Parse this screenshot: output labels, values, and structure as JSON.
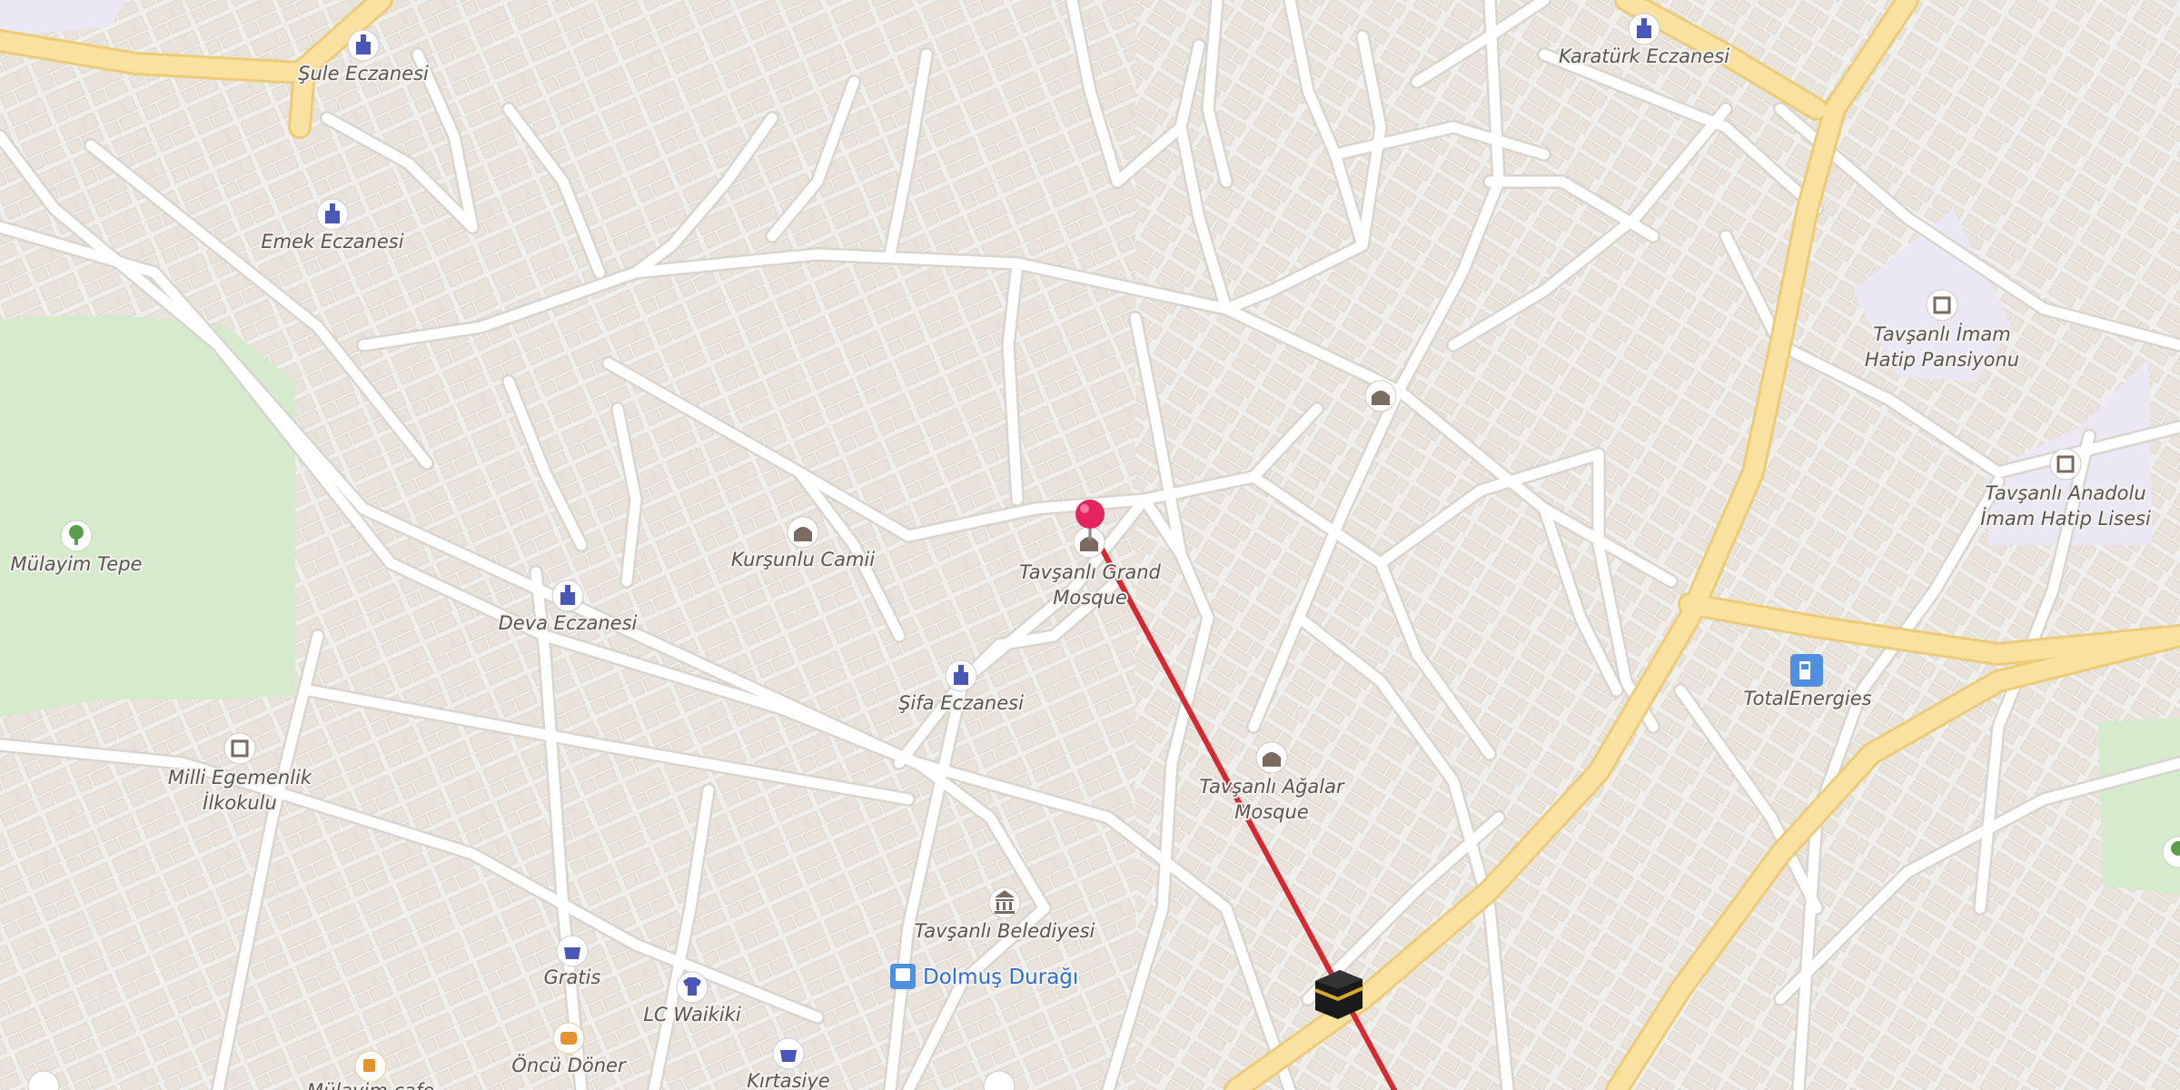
{
  "map": {
    "labels": {
      "sule_eczanesi": "Şule Eczanesi",
      "karaturk_eczanesi": "Karatürk Eczanesi",
      "emek_eczanesi": "Emek Eczanesi",
      "mulayim_tepe": "Mülayim Tepe",
      "deva_eczanesi": "Deva Eczanesi",
      "kursunlu_camii": "Kurşunlu Camii",
      "grand_mosque_l1": "Tavşanlı Grand",
      "grand_mosque_l2": "Mosque",
      "sifa_eczanesi": "Şifa Eczanesi",
      "agalar_l1": "Tavşanlı Ağalar",
      "agalar_l2": "Mosque",
      "milli_l1": "Milli Egemenlik",
      "milli_l2": "İlkokulu",
      "imam_pansiyon_l1": "Tavşanlı İmam",
      "imam_pansiyon_l2": "Hatip Pansiyonu",
      "anadolu_l1": "Tavşanlı Anadolu",
      "anadolu_l2": "İmam Hatip Lisesi",
      "totalenergies": "TotalEnergies",
      "belediye": "Tavşanlı Belediyesi",
      "dolmus": "Dolmuş Durağı",
      "gratis": "Gratis",
      "lc_waikiki": "LC Waikiki",
      "oncu_doner": "Öncü Döner",
      "kirtasiye": "Kırtasiye",
      "mulayim_cafe": "Mülayim cafe"
    },
    "icons": {
      "pharmacy": "pharmacy-icon",
      "mosque": "mosque-icon",
      "school": "school-icon",
      "fuel": "fuel-station-icon",
      "town_hall": "town-hall-icon",
      "bus_stop": "bus-stop-icon",
      "shop": "shopping-bag-icon",
      "clothes": "clothes-icon",
      "fast_food": "fast-food-icon",
      "cafe": "cafe-icon",
      "park": "tree-icon",
      "kaaba": "kaaba-icon",
      "pin": "location-pin-icon"
    },
    "colors": {
      "background": "#f1efec",
      "building": "#e9e3dc",
      "road": "#ffffff",
      "road_casing": "#dcd8d3",
      "major_road": "#fbe1a0",
      "major_road_casing": "#eccb79",
      "park": "#d5ebcb",
      "school_area": "#ebe7f5",
      "qibla_line": "#d62830",
      "pin": "#e4235f",
      "poi_blue": "#4a57b8",
      "poi_brown": "#7a6a60"
    }
  }
}
